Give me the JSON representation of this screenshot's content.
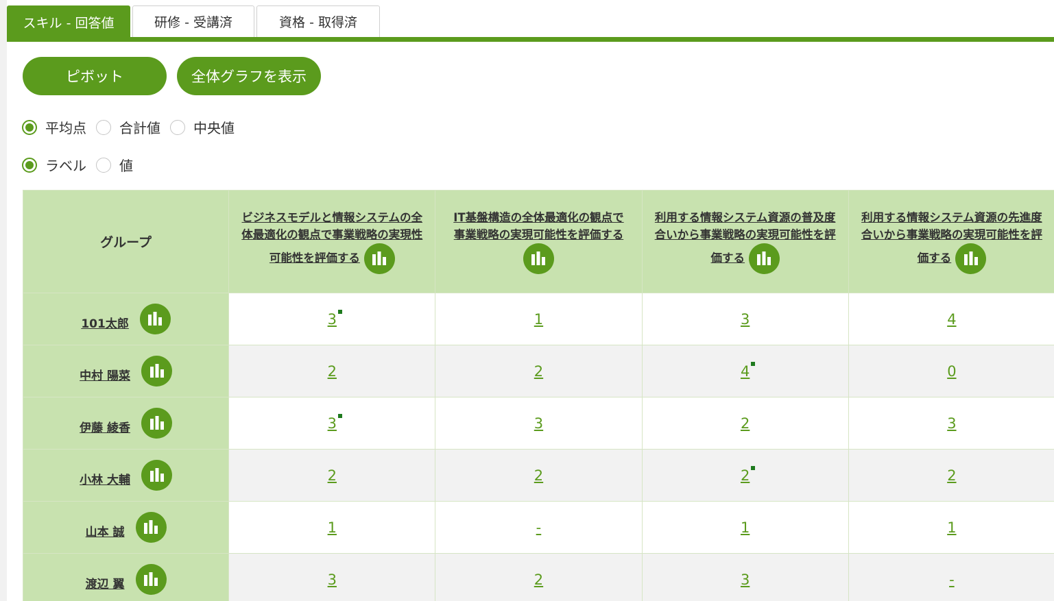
{
  "tabs": [
    {
      "label": "スキル - 回答値",
      "active": true
    },
    {
      "label": "研修 - 受講済",
      "active": false
    },
    {
      "label": "資格 - 取得済",
      "active": false
    }
  ],
  "buttons": {
    "pivot": "ピボット",
    "show_graph": "全体グラフを表示"
  },
  "aggregate_options": [
    {
      "label": "平均点",
      "checked": true
    },
    {
      "label": "合計値",
      "checked": false
    },
    {
      "label": "中央値",
      "checked": false
    }
  ],
  "display_options": [
    {
      "label": "ラベル",
      "checked": true
    },
    {
      "label": "値",
      "checked": false
    }
  ],
  "table": {
    "group_header": "グループ",
    "columns": [
      {
        "title": "ビジネスモデルと情報システムの全体最適化の観点で事業戦略の実現性可能性を評価する"
      },
      {
        "title": "IT基盤構造の全体最適化の観点で事業戦略の実現可能性を評価する"
      },
      {
        "title": "利用する情報システム資源の普及度合いから事業戦略の実現可能性を評価する"
      },
      {
        "title": "利用する情報システム資源の先進度合いから事業戦略の実現可能性を評価する"
      }
    ],
    "rows": [
      {
        "name": "101太郎",
        "values": [
          "3",
          "1",
          "3",
          "4"
        ],
        "flags": [
          true,
          false,
          false,
          false
        ]
      },
      {
        "name": "中村 陽菜",
        "values": [
          "2",
          "2",
          "4",
          "0"
        ],
        "flags": [
          false,
          false,
          true,
          false
        ]
      },
      {
        "name": "伊藤 綾香",
        "values": [
          "3",
          "3",
          "2",
          "3"
        ],
        "flags": [
          true,
          false,
          false,
          false
        ]
      },
      {
        "name": "小林 大輔",
        "values": [
          "2",
          "2",
          "2",
          "2"
        ],
        "flags": [
          false,
          false,
          true,
          false
        ]
      },
      {
        "name": "山本 誠",
        "values": [
          "1",
          "-",
          "1",
          "1"
        ],
        "flags": [
          false,
          false,
          false,
          false
        ]
      },
      {
        "name": "渡辺 翼",
        "values": [
          "3",
          "2",
          "3",
          "-"
        ],
        "flags": [
          false,
          false,
          false,
          false
        ]
      }
    ]
  },
  "colors": {
    "accent": "#5b9b1d",
    "header_bg": "#c8e2af",
    "flag": "#1e7a1e"
  }
}
